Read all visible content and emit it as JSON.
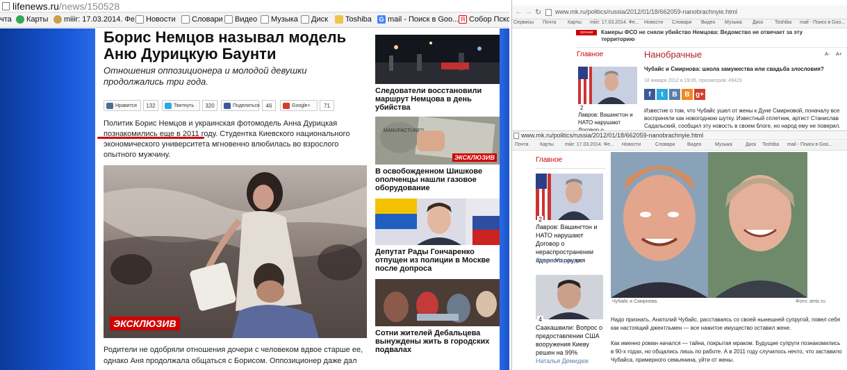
{
  "left": {
    "url_host": "lifenews.ru",
    "url_path": "/news/150528",
    "bookmarks": [
      "чта",
      "Карты",
      "miiir: 17.03.2014. Фе...",
      "Новости",
      "Словари",
      "Видео",
      "Музыка",
      "Диск",
      "Toshiba",
      "mail - Поиск в Goo...",
      "Собор Псков"
    ],
    "headline": "Борис Немцов называл модель Аню Дурицкую Баунти",
    "lead": "Отношения оппозиционера и молодой девушки продолжались три года.",
    "share": [
      {
        "label": "Нравится",
        "count": "132",
        "color": "#4c6c96"
      },
      {
        "label": "Твитнуть",
        "count": "320",
        "color": "#2aa9e0"
      },
      {
        "label": "Поделиться",
        "count": "46",
        "color": "#3b5998"
      },
      {
        "label": "Google+",
        "count": "71",
        "color": "#d23f2b"
      }
    ],
    "body1": "Политик Борис Немцов и украинская фотомодель Анна Дурицкая познакомились еще в 2011 году. Студентка Киевского национального экономического университета мгновенно влюбилась во взрослого опытного мужчину.",
    "photo_badge": "ЭКСКЛЮЗИВ",
    "body2": "Родители не одобряли отношения дочери с человеком вдвое старше ее, однако Аня продолжала общаться с Борисом. Оппозиционер даже дал ласковое",
    "sidebar": [
      {
        "title": "Следователи восстановили маршрут Немцова в день убийства",
        "badge": ""
      },
      {
        "title": "В освобожденном Шишкове ополченцы нашли газовое оборудование",
        "badge": "ЭКСКЛЮЗИВ"
      },
      {
        "title": "Депутат Рады Гончаренко отпущен из полиции в Москве после допроса",
        "badge": ""
      },
      {
        "title": "Сотни жителей Дебальцева вынуждены жить в городских подвалах",
        "badge": ""
      }
    ]
  },
  "right_top": {
    "url": "www.mk.ru/politics/russia/2012/01/18/662059-nanobrachnyie.html",
    "bookmarks": [
      "Сервисы",
      "Почта",
      "Карты",
      "miiir: 17.03.2014. Фе...",
      "Новости",
      "Словари",
      "Видео",
      "Музыка",
      "Диск",
      "Toshiba",
      "mail - Поиск в Goo..."
    ],
    "urgent_tag": "срочная новость",
    "urgent_text": "Камеры ФСО не сняли убийство Немцова: Ведомство не отвечает за эту территорию",
    "nav_main": "Главное",
    "section": "Нанобрачные",
    "font_a1": "A-",
    "font_a2": "A+",
    "title": "Чубайс и Смирнова: школа замужества или свадьба злословия?",
    "meta": "18 января 2012 в 19:05, просмотров: 49423",
    "social": [
      {
        "t": "f",
        "c": "#3b5998"
      },
      {
        "t": "t",
        "c": "#2aa9e0"
      },
      {
        "t": "B",
        "c": "#5b7fa6"
      },
      {
        "t": "B",
        "c": "#f08a24"
      },
      {
        "t": "g+",
        "c": "#d23f2b"
      }
    ],
    "rank": "2",
    "side_text": "Лавров: Вашингтон и НАТО нарушают Договор о нераспространении",
    "para": "Известие о том, что Чубайс ушел от жены к Дуне Смирновой, поначалу все восприняли как новогоднюю шутку. Известный сплетник, артист Станислав Садальский, сообщил эту новость в своем блоге, но народ ему не поверил."
  },
  "right_bottom": {
    "url": "www.mk.ru/politics/russia/2012/01/18/662059-nanobrachnyie.html",
    "bookmarks": [
      "Почта",
      "Карты",
      "miiir: 17.03.2014. Фе...",
      "Новости",
      "Словари",
      "Видео",
      "Музыка",
      "Диск",
      "Toshiba",
      "mail - Поиск в Goo..."
    ],
    "nav_main": "Главное",
    "items": [
      {
        "rank": "2",
        "title": "Лавров: Вашингтон и НАТО нарушают Договор о нераспространении ядерного оружия",
        "author": "Ольга Маранди"
      },
      {
        "rank": "4",
        "title": "Саакашвили: Вопрос о предоставлении США вооружения Киеву решен на 99%",
        "author": "Наталья Демидюк"
      }
    ],
    "caption_left": "Чубайс и Смирнова.",
    "caption_right": "Фото: amic.ru",
    "para1": "Надо признать, Анатолий Чубайс, расставаясь со своей нынешней супругой, повел себя как настоящий джентльмен — все нажитое имущество оставил жене.",
    "para2": "Как именно роман начался — тайна, покрытая мраком. Будущие супруги познакомились в 90-х годах, но общались лишь по работе. А в 2011 году случилось нечто, что заставило Чубайса, примерного семьянина, уйти от жены."
  }
}
